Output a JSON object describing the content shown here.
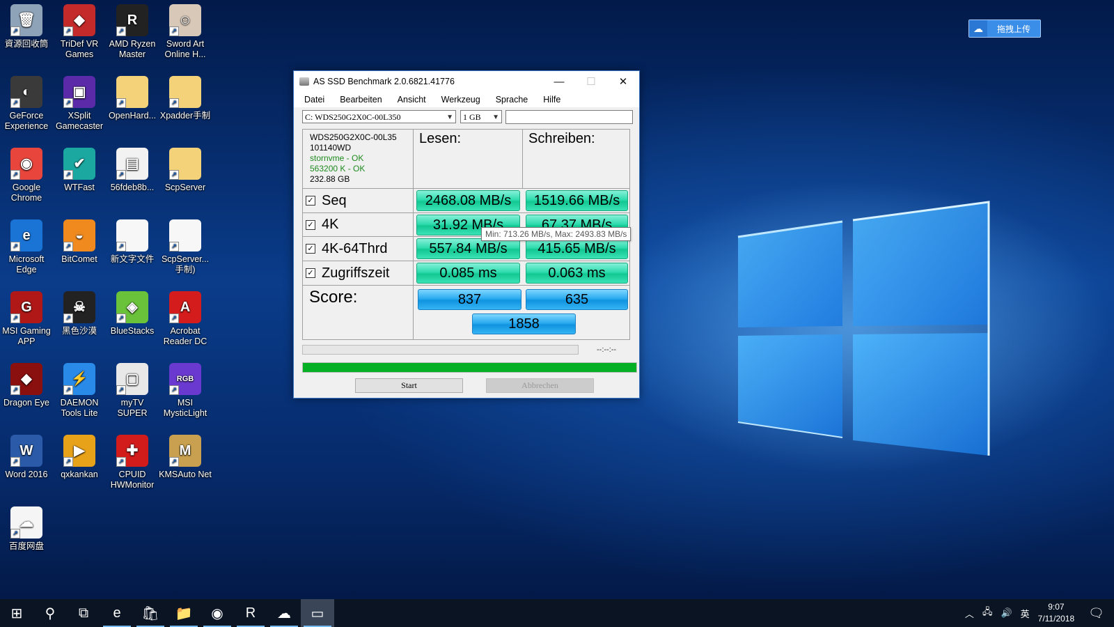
{
  "desktop": {
    "icons": [
      {
        "label": "資源回收筒",
        "icon": "recycle-bin-icon",
        "color": "#8fa3b8",
        "glyph": "🗑"
      },
      {
        "label": "TriDef VR Games",
        "icon": "tridef-icon",
        "color": "#c42a2a",
        "glyph": "◆"
      },
      {
        "label": "AMD Ryzen Master",
        "icon": "ryzen-icon",
        "color": "#222222",
        "glyph": "R"
      },
      {
        "label": "Sword Art Online H...",
        "icon": "sao-icon",
        "color": "#d8c8b8",
        "glyph": "☺"
      },
      {
        "label": "GeForce Experience",
        "icon": "geforce-icon",
        "color": "#3a3a3a",
        "glyph": "◐"
      },
      {
        "label": "XSplit Gamecaster",
        "icon": "xsplit-icon",
        "color": "#5a2aa8",
        "glyph": "▣"
      },
      {
        "label": "OpenHard...",
        "icon": "folder-icon",
        "color": "#f3d27a",
        "glyph": ""
      },
      {
        "label": "Xpadder手制",
        "icon": "folder-icon",
        "color": "#f3d27a",
        "glyph": ""
      },
      {
        "label": "Google Chrome",
        "icon": "chrome-icon",
        "color": "#e8453c",
        "glyph": "◉"
      },
      {
        "label": "WTFast",
        "icon": "wtfast-icon",
        "color": "#1aa8a0",
        "glyph": "✔"
      },
      {
        "label": "56fdeb8b...",
        "icon": "document-image-icon",
        "color": "#f2f2f2",
        "glyph": "▤"
      },
      {
        "label": "ScpServer",
        "icon": "folder-icon",
        "color": "#f3d27a",
        "glyph": ""
      },
      {
        "label": "Microsoft Edge",
        "icon": "edge-icon",
        "color": "#1a74d6",
        "glyph": "e"
      },
      {
        "label": "BitComet",
        "icon": "bitcomet-icon",
        "color": "#f08a1e",
        "glyph": "◒"
      },
      {
        "label": "新文字文件",
        "icon": "text-file-icon",
        "color": "#f7f7f7",
        "glyph": ""
      },
      {
        "label": "ScpServer...手制)",
        "icon": "text-file-icon",
        "color": "#f7f7f7",
        "glyph": ""
      },
      {
        "label": "MSI Gaming APP",
        "icon": "msi-gaming-icon",
        "color": "#b01818",
        "glyph": "G"
      },
      {
        "label": "黑色沙漠",
        "icon": "black-desert-icon",
        "color": "#222222",
        "glyph": "☠"
      },
      {
        "label": "BlueStacks",
        "icon": "bluestacks-icon",
        "color": "#6ac23a",
        "glyph": "◈"
      },
      {
        "label": "Acrobat Reader DC",
        "icon": "acrobat-icon",
        "color": "#d41c1c",
        "glyph": "A"
      },
      {
        "label": "Dragon Eye",
        "icon": "dragon-eye-icon",
        "color": "#8a1010",
        "glyph": "◆"
      },
      {
        "label": "DAEMON Tools Lite",
        "icon": "daemon-tools-icon",
        "color": "#2a8ae8",
        "glyph": "⚡"
      },
      {
        "label": "myTV SUPER",
        "icon": "mytv-icon",
        "color": "#e8e8e8",
        "glyph": "▢"
      },
      {
        "label": "MSI MysticLight",
        "icon": "mysticlight-icon",
        "color": "#6a3ad0",
        "glyph": "RGB"
      },
      {
        "label": "Word 2016",
        "icon": "word-icon",
        "color": "#2a5aa8",
        "glyph": "W"
      },
      {
        "label": "qxkankan",
        "icon": "qxkankan-icon",
        "color": "#e8a21a",
        "glyph": "▶"
      },
      {
        "label": "CPUID HWMonitor",
        "icon": "hwmonitor-icon",
        "color": "#d21c1c",
        "glyph": "✚"
      },
      {
        "label": "KMSAuto Net",
        "icon": "kmsauto-icon",
        "color": "#c8a050",
        "glyph": "M"
      },
      {
        "label": "百度网盘",
        "icon": "baidu-netdisk-icon",
        "color": "#f5f5f5",
        "glyph": "☁"
      }
    ]
  },
  "baidu_widget": {
    "label": "拖拽上传"
  },
  "app": {
    "title": "AS SSD Benchmark 2.0.6821.41776",
    "menu": [
      "Datei",
      "Bearbeiten",
      "Ansicht",
      "Werkzeug",
      "Sprache",
      "Hilfe"
    ],
    "drive_select": "C: WDS250G2X0C-00L350",
    "size_select": "1 GB",
    "drive_info": {
      "model": "WDS250G2X0C-00L35",
      "firmware": "101140WD",
      "driver": "stornvme - OK",
      "alignment": "563200 K - OK",
      "capacity": "232.88 GB"
    },
    "col_read": "Lesen:",
    "col_write": "Schreiben:",
    "tests": [
      {
        "name": "Seq",
        "read": "2468.08 MB/s",
        "write": "1519.66 MB/s"
      },
      {
        "name": "4K",
        "read": "31.92 MB/s",
        "write": "67.37 MB/s"
      },
      {
        "name": "4K-64Thrd",
        "read": "557.84 MB/s",
        "write": "415.65 MB/s"
      },
      {
        "name": "Zugriffszeit",
        "read": "0.085 ms",
        "write": "0.063 ms"
      }
    ],
    "tooltip": "Min: 713.26 MB/s, Max: 2493.83 MB/s",
    "score_label": "Score:",
    "score_read": "837",
    "score_write": "635",
    "score_total": "1858",
    "timer": "--:--:--",
    "progress_total": 1.0,
    "start": "Start",
    "abort": "Abbrechen"
  },
  "taskbar": {
    "items": [
      {
        "icon": "windows-start-icon",
        "glyph": "⊞"
      },
      {
        "icon": "search-icon",
        "glyph": "⚲"
      },
      {
        "icon": "task-view-icon",
        "glyph": "⧉"
      },
      {
        "icon": "edge-icon",
        "glyph": "e"
      },
      {
        "icon": "store-icon",
        "glyph": "🛍"
      },
      {
        "icon": "file-explorer-icon",
        "glyph": "📁"
      },
      {
        "icon": "chrome-icon",
        "glyph": "◉"
      },
      {
        "icon": "ryzen-icon",
        "glyph": "R"
      },
      {
        "icon": "baidu-netdisk-icon",
        "glyph": "☁"
      },
      {
        "icon": "as-ssd-icon",
        "glyph": "▭"
      }
    ],
    "ime": "英",
    "time": "9:07",
    "date": "7/11/2018"
  }
}
